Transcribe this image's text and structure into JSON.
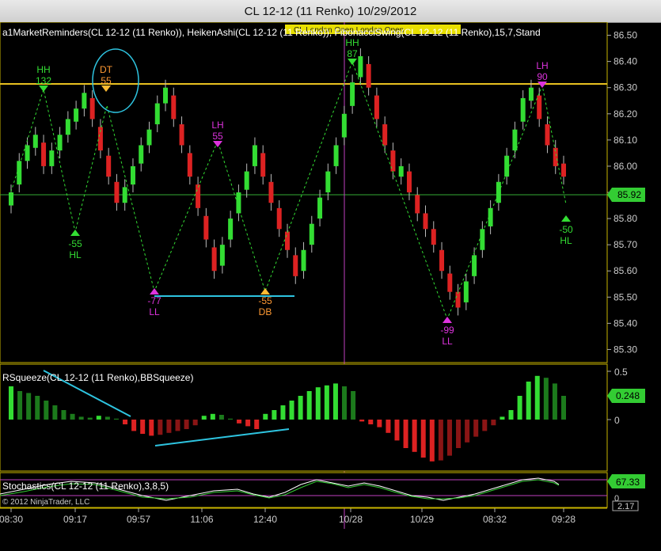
{
  "window": {
    "title": "CL 12-12 (11 Renko)  10/29/2012"
  },
  "colors": {
    "background": "#000000",
    "bull": "#33dd33",
    "bear": "#dd2222",
    "bull_dark": "#1c7a1c",
    "bear_dark": "#8a1515",
    "zigzag": "#33dd33",
    "resistance": "#e8c020",
    "support": "#2ec4e0",
    "vline": "#c040c0",
    "last_price_badge": "#33cc33"
  },
  "main_panel": {
    "indicator_text": "a1MarketReminders(CL 12-12 (11 Renko)), HeikenAshi(CL 12-12 (11 Renko)), FibonacciSwing(CL 12-12 (11 Renko),15,7,Stand",
    "reminder_banner": "CL London Open  London Open",
    "last_price": "85.92",
    "yticks": [
      "86.50",
      "86.40",
      "86.30",
      "86.20",
      "86.10",
      "86.00",
      "85.90",
      "85.80",
      "85.70",
      "85.60",
      "85.50",
      "85.40",
      "85.30"
    ],
    "swing_labels": [
      {
        "type": "HH",
        "value": "132",
        "color": "#33dd33"
      },
      {
        "type": "DT",
        "value": "55",
        "color": "#ff9933"
      },
      {
        "type": "HL",
        "value": "-55",
        "color": "#33dd33"
      },
      {
        "type": "LH",
        "value": "55",
        "color": "#dd33dd"
      },
      {
        "type": "LL",
        "value": "-77",
        "color": "#dd33dd"
      },
      {
        "type": "DB",
        "value": "-55",
        "color": "#ff9933"
      },
      {
        "type": "HH",
        "value": "87",
        "color": "#33dd33"
      },
      {
        "type": "LL",
        "value": "-99",
        "color": "#dd33dd"
      },
      {
        "type": "LH",
        "value": "90",
        "color": "#dd33dd"
      },
      {
        "type": "HL",
        "value": "-50",
        "color": "#33dd33"
      }
    ]
  },
  "squeeze_panel": {
    "label": "RSqueeze(CL 12-12 (11 Renko),BBSqueeze)",
    "yticks": [
      "0.5",
      "0"
    ],
    "last_value": "0.248"
  },
  "stoch_panel": {
    "label": "Stochastics(CL 12-12 (11 Renko),3,8,5)",
    "copyright": "© 2012 NinjaTrader, LLC",
    "last_value": "67.33",
    "extra_value": "2.17",
    "ytick": "0"
  },
  "time_axis": [
    "08:30",
    "09:17",
    "09:57",
    "11:06",
    "12:40",
    "10/28",
    "10/29",
    "08:32",
    "09:28"
  ],
  "chart_data": {
    "type": "candlestick",
    "bars_close": [
      85.9,
      86.02,
      86.08,
      86.12,
      86.0,
      86.06,
      86.12,
      86.18,
      86.22,
      86.28,
      86.18,
      86.06,
      85.96,
      85.86,
      85.92,
      86.0,
      86.08,
      86.14,
      86.24,
      86.3,
      86.18,
      86.08,
      85.96,
      85.84,
      85.72,
      85.6,
      85.7,
      85.8,
      85.9,
      85.98,
      86.08,
      85.96,
      85.86,
      85.76,
      85.68,
      85.58,
      85.68,
      85.78,
      85.88,
      85.98,
      86.08,
      86.2,
      86.32,
      86.42,
      86.3,
      86.18,
      86.08,
      85.98,
      86.0,
      85.9,
      85.82,
      85.76,
      85.7,
      85.6,
      85.52,
      85.46,
      85.56,
      85.66,
      85.76,
      85.84,
      85.94,
      86.04,
      86.14,
      86.26,
      86.3,
      86.18,
      86.08,
      86.0,
      85.96
    ],
    "squeeze_values": [
      0.35,
      0.3,
      0.28,
      0.25,
      0.2,
      0.15,
      0.1,
      0.06,
      0.03,
      0.02,
      0.04,
      0.03,
      0.01,
      -0.05,
      -0.12,
      -0.15,
      -0.17,
      -0.16,
      -0.14,
      -0.12,
      -0.1,
      -0.06,
      0.04,
      0.06,
      0.05,
      0.01,
      -0.04,
      -0.07,
      -0.1,
      0.06,
      0.1,
      0.15,
      0.2,
      0.25,
      0.3,
      0.34,
      0.36,
      0.38,
      0.35,
      0.3,
      -0.02,
      -0.05,
      -0.08,
      -0.14,
      -0.22,
      -0.3,
      -0.34,
      -0.4,
      -0.44,
      -0.43,
      -0.38,
      -0.3,
      -0.24,
      -0.18,
      -0.12,
      -0.06,
      0.03,
      0.1,
      0.25,
      0.4,
      0.46,
      0.44,
      0.38,
      0.25
    ],
    "ylim": [
      85.25,
      86.55
    ],
    "squeeze_ylim": [
      -0.5,
      0.6
    ]
  }
}
